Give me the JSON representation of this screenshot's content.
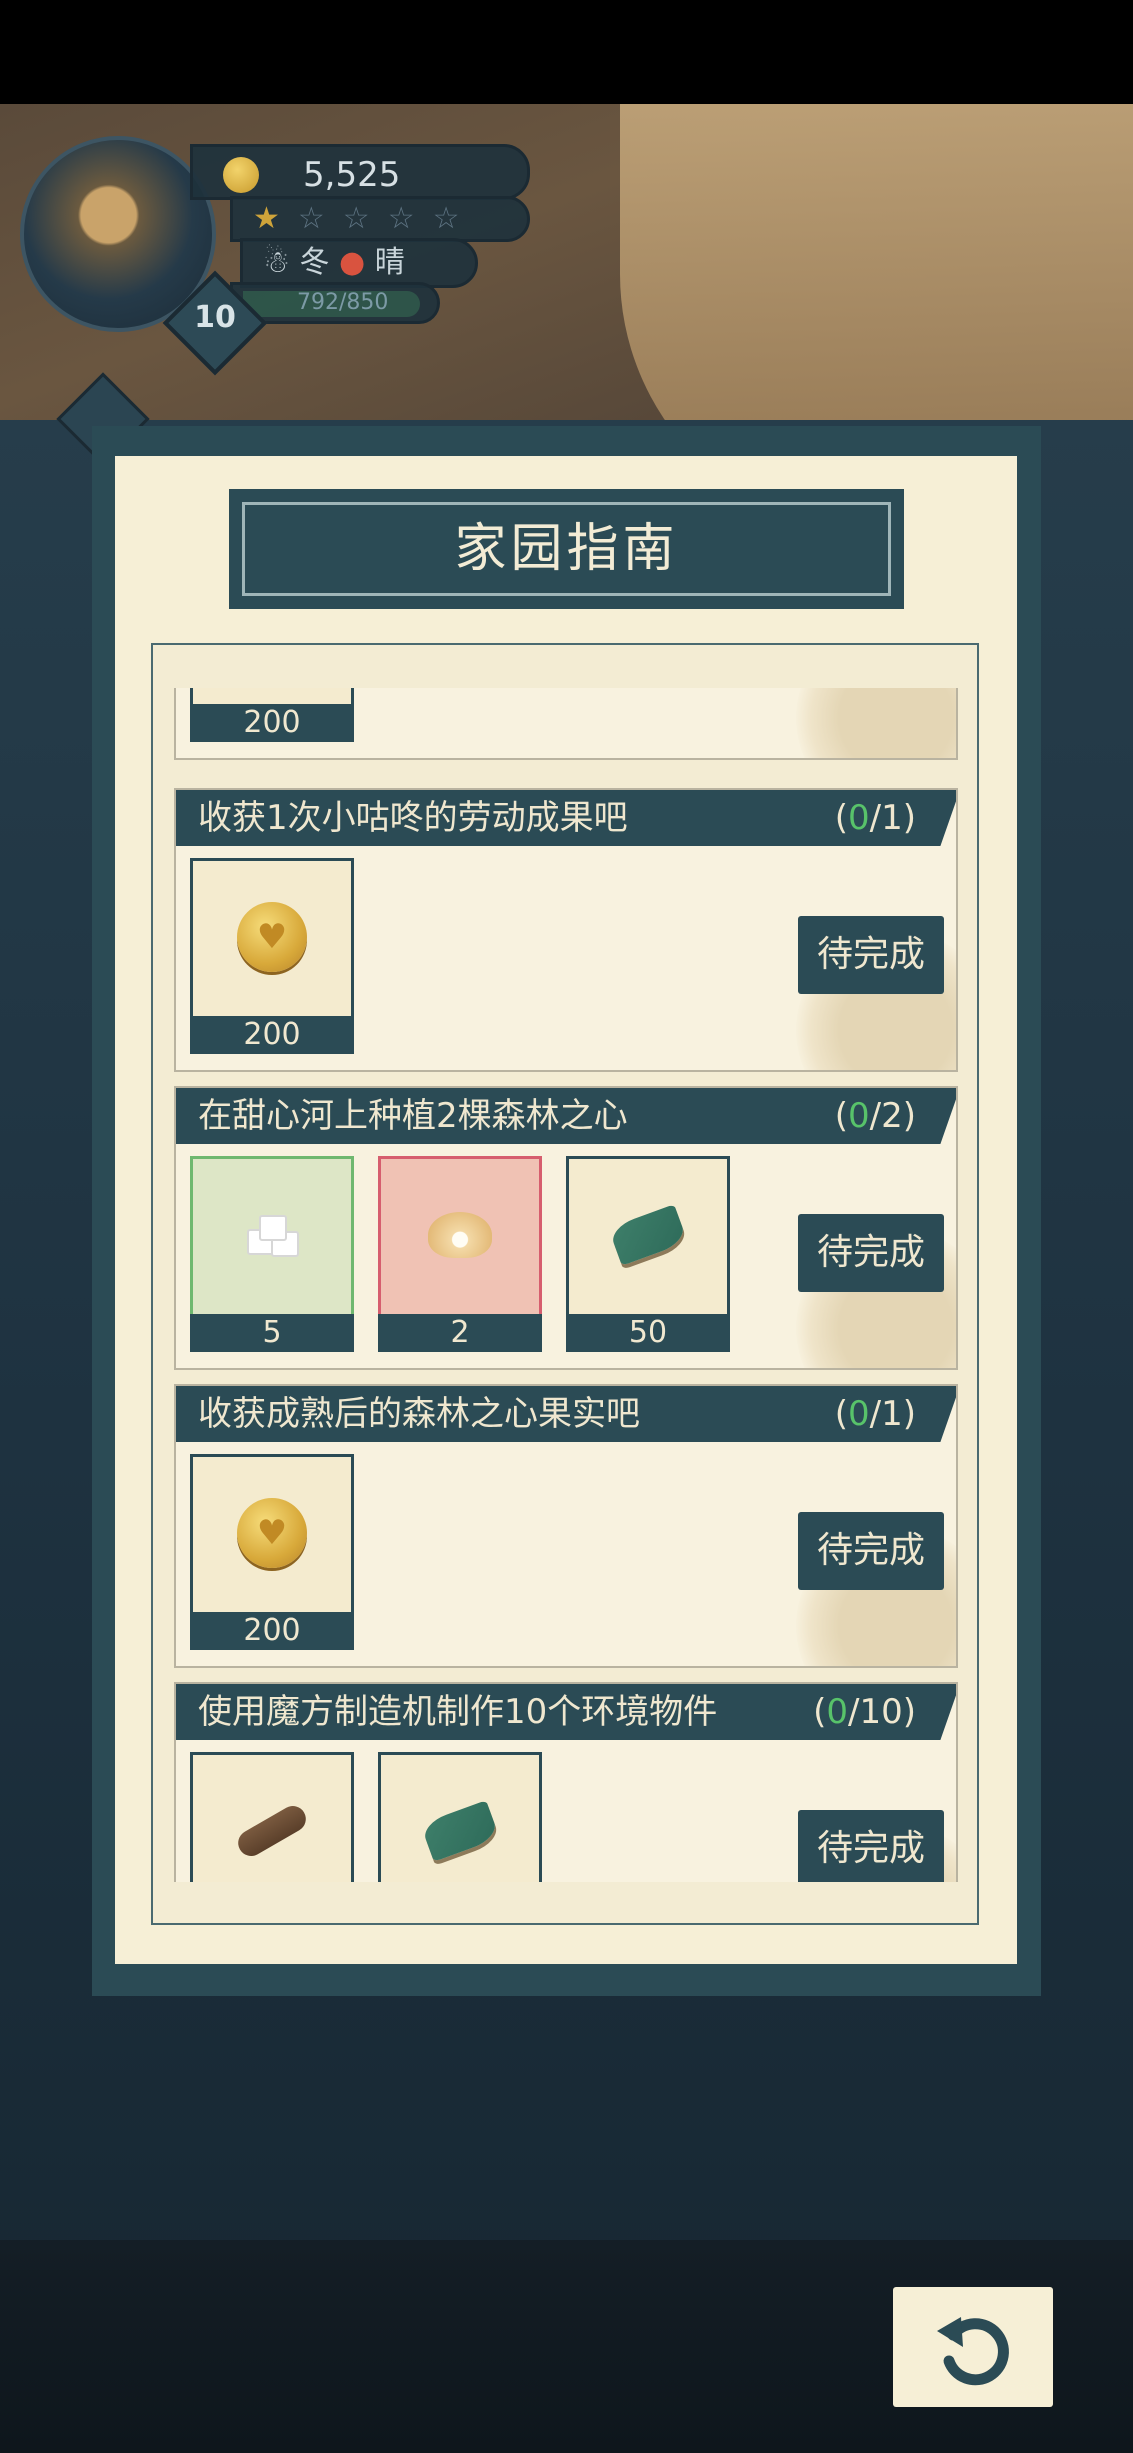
{
  "hud": {
    "coins": "5,525",
    "stars_filled": 1,
    "stars_total": 5,
    "season": "冬",
    "weather": "晴",
    "exp": "792/850",
    "exp_fraction": 0.93,
    "level": "10"
  },
  "panel": {
    "title": "家园指南",
    "partial_top_count": "200",
    "tasks": [
      {
        "title": "收获1次小咕咚的劳动成果吧",
        "progress_open": "(",
        "progress_current": "0",
        "progress_rest": "/1)",
        "rewards": [
          {
            "icon": "gold-coin-icon",
            "count": "200"
          }
        ],
        "button": "待完成"
      },
      {
        "title": "在甜心河上种植2棵森林之心",
        "progress_open": "(",
        "progress_current": "0",
        "progress_rest": "/2)",
        "rewards": [
          {
            "icon": "sugar-cube-icon",
            "count": "5"
          },
          {
            "icon": "pearl-shell-icon",
            "count": "2"
          },
          {
            "icon": "leaf-bundle-icon",
            "count": "50"
          }
        ],
        "button": "待完成"
      },
      {
        "title": "收获成熟后的森林之心果实吧",
        "progress_open": "(",
        "progress_current": "0",
        "progress_rest": "/1)",
        "rewards": [
          {
            "icon": "gold-coin-icon",
            "count": "200"
          }
        ],
        "button": "待完成"
      },
      {
        "title": "使用魔方制造机制作10个环境物件",
        "progress_open": "(",
        "progress_current": "0",
        "progress_rest": "/10)",
        "rewards": [
          {
            "icon": "wood-log-icon",
            "count": ""
          },
          {
            "icon": "leaf-bundle-icon",
            "count": ""
          }
        ],
        "button": "待完成"
      }
    ]
  },
  "colors": {
    "panel_dark": "#2b4b55",
    "panel_cream": "#f6efd6",
    "progress_green": "#58c36a"
  },
  "back_button_icon": "undo-arrow-icon"
}
